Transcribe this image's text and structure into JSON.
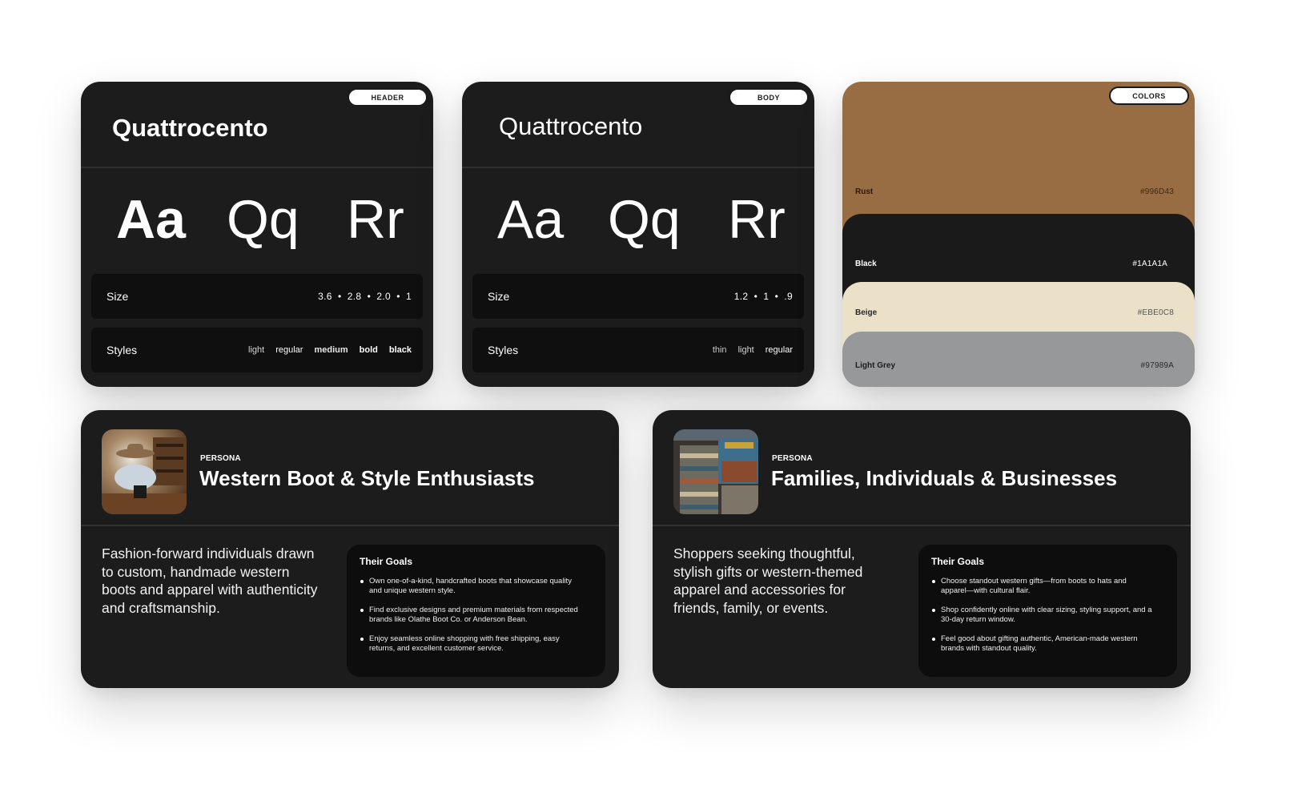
{
  "header_card": {
    "pill": "HEADER",
    "font_name": "Quattrocento",
    "glyphs": [
      "Aa",
      "Qq",
      "Rr"
    ],
    "size_label": "Size",
    "size_values": "3.6  •  2.8  •  2.0  •  1",
    "styles_label": "Styles",
    "styles": [
      "light",
      "regular",
      "medium",
      "bold",
      "black"
    ]
  },
  "body_card": {
    "pill": "BODY",
    "font_name": "Quattrocento",
    "glyphs": [
      "Aa",
      "Qq",
      "Rr"
    ],
    "size_label": "Size",
    "size_values": "1.2  •  1  •  .9",
    "styles_label": "Styles",
    "styles": [
      "thin",
      "light",
      "regular"
    ]
  },
  "colors_card": {
    "pill": "COLORS",
    "swatches": [
      {
        "name": "Rust",
        "hex": "#996D43",
        "color": "#996D43"
      },
      {
        "name": "Black",
        "hex": "#1A1A1A",
        "color": "#1A1A1A"
      },
      {
        "name": "Beige",
        "hex": "#EBE0C8",
        "color": "#EBE0C8"
      },
      {
        "name": "Light Grey",
        "hex": "#97989A",
        "color": "#97989A"
      }
    ]
  },
  "personas": [
    {
      "kicker": "PERSONA",
      "title": "Western Boot & Style Enthusiasts",
      "description": "Fashion-forward individuals drawn to custom, handmade western boots and apparel with authenticity and craftsmanship.",
      "goals_title": "Their Goals",
      "goals": [
        "Own one-of-a-kind, handcrafted boots that showcase quality and unique western style.",
        "Find exclusive designs and premium materials from respected brands like Olathe Boot Co. or Anderson Bean.",
        "Enjoy seamless online shopping with free shipping, easy returns, and excellent customer service."
      ]
    },
    {
      "kicker": "PERSONA",
      "title": "Families, Individuals & Businesses",
      "description": "Shoppers seeking thoughtful, stylish gifts or western-themed apparel and accessories for friends, family, or events.",
      "goals_title": "Their Goals",
      "goals": [
        "Choose standout western gifts—from boots to hats and apparel—with cultural flair.",
        "Shop confidently online with clear sizing, styling support, and a 30-day return window.",
        "Feel good about gifting authentic, American-made western brands with standout quality."
      ]
    }
  ]
}
